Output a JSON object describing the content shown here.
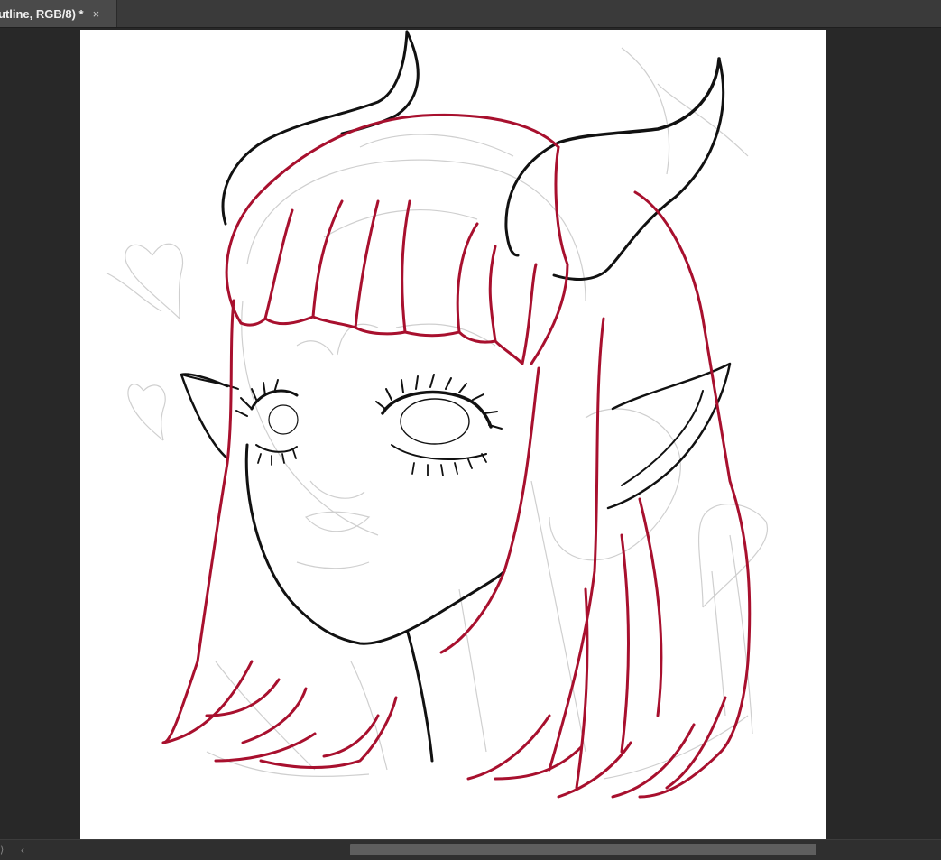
{
  "document_tab": {
    "title": "utline, RGB/8) *",
    "close_glyph": "×"
  },
  "scrollbar": {
    "left_arrow": "‹",
    "edge_glyph": "⟩"
  },
  "colors": {
    "workspace_bg": "#282828",
    "canvas_bg": "#ffffff",
    "hair_line": "#a8102e",
    "ink_line": "#111111",
    "sketch_line": "#c9c9c9"
  },
  "icons": {
    "tab_close": "close-icon",
    "scroll_left": "chevron-left-icon"
  }
}
